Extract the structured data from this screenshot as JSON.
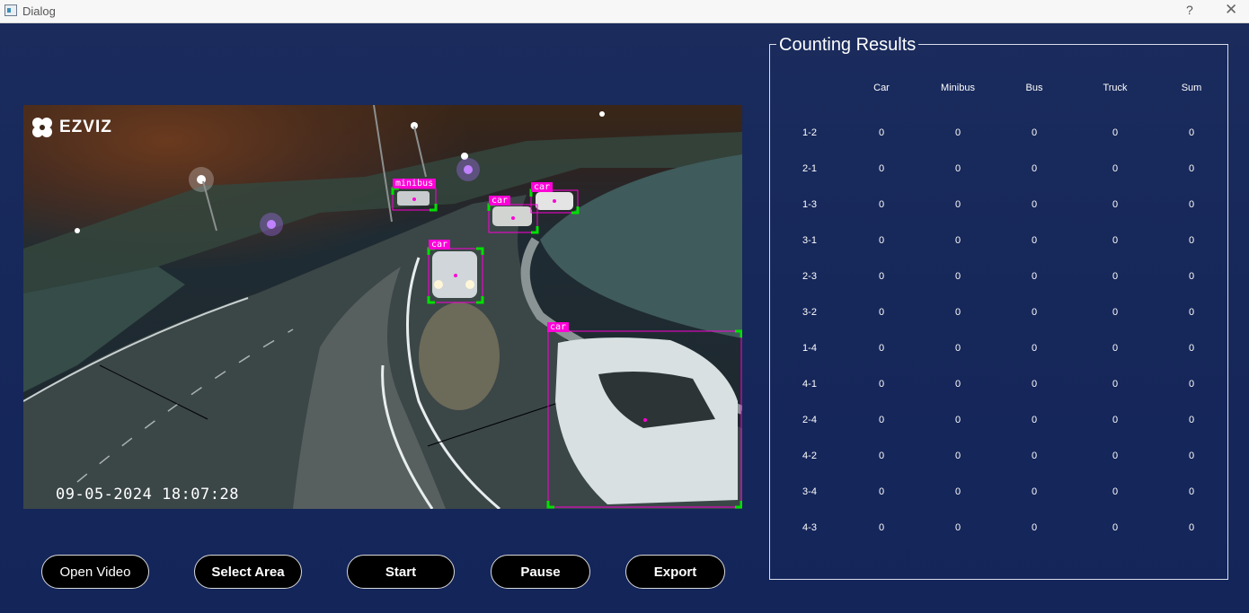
{
  "window": {
    "title": "Dialog",
    "help_label": "?",
    "close_label": "✕"
  },
  "video": {
    "logo_text": "EZVIZ",
    "timestamp": "09-05-2024 18:07:28",
    "detections": [
      {
        "label": "minibus"
      },
      {
        "label": "car"
      },
      {
        "label": "car"
      },
      {
        "label": "car"
      },
      {
        "label": "car"
      }
    ]
  },
  "buttons": {
    "open_video": "Open Video",
    "select_area": "Select Area",
    "start": "Start",
    "pause": "Pause",
    "export": "Export"
  },
  "results": {
    "title": "Counting Results",
    "columns": [
      "Car",
      "Minibus",
      "Bus",
      "Truck",
      "Sum"
    ],
    "rows": [
      {
        "label": "1-2",
        "values": [
          "0",
          "0",
          "0",
          "0",
          "0"
        ]
      },
      {
        "label": "2-1",
        "values": [
          "0",
          "0",
          "0",
          "0",
          "0"
        ]
      },
      {
        "label": "1-3",
        "values": [
          "0",
          "0",
          "0",
          "0",
          "0"
        ]
      },
      {
        "label": "3-1",
        "values": [
          "0",
          "0",
          "0",
          "0",
          "0"
        ]
      },
      {
        "label": "2-3",
        "values": [
          "0",
          "0",
          "0",
          "0",
          "0"
        ]
      },
      {
        "label": "3-2",
        "values": [
          "0",
          "0",
          "0",
          "0",
          "0"
        ]
      },
      {
        "label": "1-4",
        "values": [
          "0",
          "0",
          "0",
          "0",
          "0"
        ]
      },
      {
        "label": "4-1",
        "values": [
          "0",
          "0",
          "0",
          "0",
          "0"
        ]
      },
      {
        "label": "2-4",
        "values": [
          "0",
          "0",
          "0",
          "0",
          "0"
        ]
      },
      {
        "label": "4-2",
        "values": [
          "0",
          "0",
          "0",
          "0",
          "0"
        ]
      },
      {
        "label": "3-4",
        "values": [
          "0",
          "0",
          "0",
          "0",
          "0"
        ]
      },
      {
        "label": "4-3",
        "values": [
          "0",
          "0",
          "0",
          "0",
          "0"
        ]
      }
    ]
  },
  "colors": {
    "background": "#1b2a5b",
    "detection_magenta": "#ff00d8",
    "detection_green": "#00e000",
    "button_bg": "#000000"
  }
}
